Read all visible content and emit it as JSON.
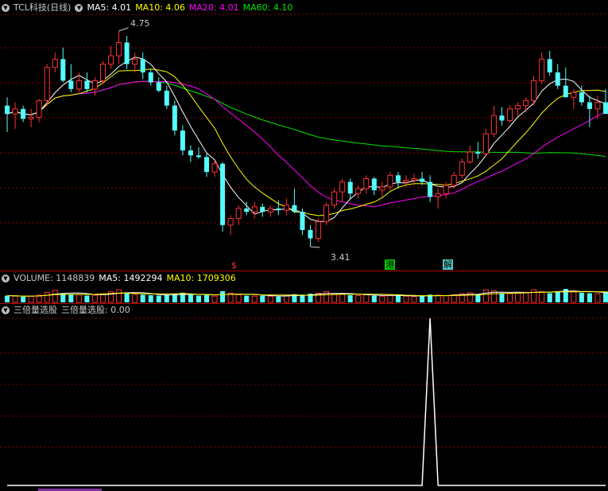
{
  "price_panel": {
    "title": "TCL科技(日线)",
    "ma5_label": "MA5: 4.01",
    "ma10_label": "MA10: 4.06",
    "ma20_label": "MA20: 4.01",
    "ma60_label": "MA60: 4.10",
    "high_label": "4.75",
    "low_label": "3.41",
    "markers": [
      "$",
      "港",
      "解"
    ]
  },
  "volume_panel": {
    "label": "VOLUME: 1148839",
    "ma5_label": "MA5: 1492294",
    "ma10_label": "MA10: 1709306"
  },
  "indicator_panel": {
    "title": "三倍量选股",
    "value_label": "三倍量选股: 0.00"
  },
  "colors": {
    "up": "#ff3232",
    "down": "#54fcfc",
    "ma5": "#ffffff",
    "ma10": "#ffff00",
    "ma20": "#ff00ff",
    "ma60": "#00e600",
    "grid": "#8b0000"
  },
  "chart_data": {
    "type": "candlestick",
    "price_range": [
      3.33,
      4.85
    ],
    "candles": [
      {
        "o": 4.3,
        "h": 4.35,
        "l": 4.14,
        "c": 4.25
      },
      {
        "o": 4.25,
        "h": 4.32,
        "l": 4.16,
        "c": 4.28
      },
      {
        "o": 4.28,
        "h": 4.3,
        "l": 4.2,
        "c": 4.22
      },
      {
        "o": 4.22,
        "h": 4.28,
        "l": 4.17,
        "c": 4.23
      },
      {
        "o": 4.23,
        "h": 4.34,
        "l": 4.2,
        "c": 4.33
      },
      {
        "o": 4.33,
        "h": 4.55,
        "l": 4.3,
        "c": 4.53
      },
      {
        "o": 4.53,
        "h": 4.62,
        "l": 4.5,
        "c": 4.58
      },
      {
        "o": 4.58,
        "h": 4.65,
        "l": 4.44,
        "c": 4.45
      },
      {
        "o": 4.45,
        "h": 4.55,
        "l": 4.38,
        "c": 4.4
      },
      {
        "o": 4.4,
        "h": 4.5,
        "l": 4.38,
        "c": 4.45
      },
      {
        "o": 4.45,
        "h": 4.5,
        "l": 4.38,
        "c": 4.4
      },
      {
        "o": 4.4,
        "h": 4.47,
        "l": 4.36,
        "c": 4.45
      },
      {
        "o": 4.45,
        "h": 4.57,
        "l": 4.43,
        "c": 4.55
      },
      {
        "o": 4.55,
        "h": 4.66,
        "l": 4.52,
        "c": 4.6
      },
      {
        "o": 4.6,
        "h": 4.75,
        "l": 4.55,
        "c": 4.68
      },
      {
        "o": 4.68,
        "h": 4.72,
        "l": 4.52,
        "c": 4.55
      },
      {
        "o": 4.55,
        "h": 4.62,
        "l": 4.5,
        "c": 4.58
      },
      {
        "o": 4.58,
        "h": 4.62,
        "l": 4.46,
        "c": 4.5
      },
      {
        "o": 4.5,
        "h": 4.52,
        "l": 4.42,
        "c": 4.44
      },
      {
        "o": 4.44,
        "h": 4.47,
        "l": 4.38,
        "c": 4.39
      },
      {
        "o": 4.39,
        "h": 4.42,
        "l": 4.28,
        "c": 4.3
      },
      {
        "o": 4.3,
        "h": 4.33,
        "l": 4.12,
        "c": 4.15
      },
      {
        "o": 4.15,
        "h": 4.18,
        "l": 4.0,
        "c": 4.03
      },
      {
        "o": 4.03,
        "h": 4.06,
        "l": 3.96,
        "c": 4.0
      },
      {
        "o": 4.0,
        "h": 4.05,
        "l": 3.98,
        "c": 3.99
      },
      {
        "o": 3.99,
        "h": 4.01,
        "l": 3.87,
        "c": 3.9
      },
      {
        "o": 3.9,
        "h": 3.97,
        "l": 3.87,
        "c": 3.95
      },
      {
        "o": 3.95,
        "h": 3.96,
        "l": 3.54,
        "c": 3.58
      },
      {
        "o": 3.58,
        "h": 3.64,
        "l": 3.52,
        "c": 3.62
      },
      {
        "o": 3.62,
        "h": 3.7,
        "l": 3.58,
        "c": 3.68
      },
      {
        "o": 3.68,
        "h": 3.72,
        "l": 3.64,
        "c": 3.66
      },
      {
        "o": 3.66,
        "h": 3.72,
        "l": 3.62,
        "c": 3.69
      },
      {
        "o": 3.69,
        "h": 3.71,
        "l": 3.63,
        "c": 3.66
      },
      {
        "o": 3.66,
        "h": 3.7,
        "l": 3.63,
        "c": 3.68
      },
      {
        "o": 3.68,
        "h": 3.73,
        "l": 3.64,
        "c": 3.67
      },
      {
        "o": 3.67,
        "h": 3.74,
        "l": 3.64,
        "c": 3.7
      },
      {
        "o": 3.7,
        "h": 3.8,
        "l": 3.65,
        "c": 3.66
      },
      {
        "o": 3.66,
        "h": 3.68,
        "l": 3.52,
        "c": 3.55
      },
      {
        "o": 3.55,
        "h": 3.58,
        "l": 3.45,
        "c": 3.5
      },
      {
        "o": 3.5,
        "h": 3.62,
        "l": 3.48,
        "c": 3.6
      },
      {
        "o": 3.6,
        "h": 3.72,
        "l": 3.58,
        "c": 3.7
      },
      {
        "o": 3.7,
        "h": 3.8,
        "l": 3.68,
        "c": 3.78
      },
      {
        "o": 3.78,
        "h": 3.86,
        "l": 3.72,
        "c": 3.84
      },
      {
        "o": 3.84,
        "h": 3.86,
        "l": 3.74,
        "c": 3.77
      },
      {
        "o": 3.77,
        "h": 3.82,
        "l": 3.74,
        "c": 3.8
      },
      {
        "o": 3.8,
        "h": 3.88,
        "l": 3.77,
        "c": 3.86
      },
      {
        "o": 3.86,
        "h": 3.87,
        "l": 3.76,
        "c": 3.79
      },
      {
        "o": 3.79,
        "h": 3.84,
        "l": 3.75,
        "c": 3.81
      },
      {
        "o": 3.81,
        "h": 3.9,
        "l": 3.79,
        "c": 3.88
      },
      {
        "o": 3.88,
        "h": 3.9,
        "l": 3.8,
        "c": 3.84
      },
      {
        "o": 3.84,
        "h": 3.88,
        "l": 3.81,
        "c": 3.85
      },
      {
        "o": 3.85,
        "h": 3.89,
        "l": 3.82,
        "c": 3.86
      },
      {
        "o": 3.86,
        "h": 3.9,
        "l": 3.82,
        "c": 3.84
      },
      {
        "o": 3.84,
        "h": 3.88,
        "l": 3.72,
        "c": 3.75
      },
      {
        "o": 3.75,
        "h": 3.8,
        "l": 3.68,
        "c": 3.77
      },
      {
        "o": 3.77,
        "h": 3.84,
        "l": 3.74,
        "c": 3.82
      },
      {
        "o": 3.82,
        "h": 3.9,
        "l": 3.8,
        "c": 3.88
      },
      {
        "o": 3.88,
        "h": 3.98,
        "l": 3.86,
        "c": 3.96
      },
      {
        "o": 3.96,
        "h": 4.06,
        "l": 3.95,
        "c": 4.02
      },
      {
        "o": 4.02,
        "h": 4.08,
        "l": 3.98,
        "c": 4.01
      },
      {
        "o": 4.01,
        "h": 4.16,
        "l": 4.0,
        "c": 4.13
      },
      {
        "o": 4.13,
        "h": 4.3,
        "l": 4.11,
        "c": 4.24
      },
      {
        "o": 4.24,
        "h": 4.29,
        "l": 4.18,
        "c": 4.21
      },
      {
        "o": 4.21,
        "h": 4.3,
        "l": 4.2,
        "c": 4.28
      },
      {
        "o": 4.28,
        "h": 4.32,
        "l": 4.24,
        "c": 4.3
      },
      {
        "o": 4.3,
        "h": 4.35,
        "l": 4.26,
        "c": 4.33
      },
      {
        "o": 4.33,
        "h": 4.48,
        "l": 4.3,
        "c": 4.45
      },
      {
        "o": 4.45,
        "h": 4.62,
        "l": 4.43,
        "c": 4.58
      },
      {
        "o": 4.58,
        "h": 4.63,
        "l": 4.48,
        "c": 4.5
      },
      {
        "o": 4.5,
        "h": 4.55,
        "l": 4.4,
        "c": 4.42
      },
      {
        "o": 4.42,
        "h": 4.53,
        "l": 4.36,
        "c": 4.35
      },
      {
        "o": 4.35,
        "h": 4.4,
        "l": 4.28,
        "c": 4.38
      },
      {
        "o": 4.38,
        "h": 4.42,
        "l": 4.3,
        "c": 4.32
      },
      {
        "o": 4.32,
        "h": 4.36,
        "l": 4.17,
        "c": 4.28
      },
      {
        "o": 4.28,
        "h": 4.36,
        "l": 4.22,
        "c": 4.32
      },
      {
        "o": 4.32,
        "h": 4.4,
        "l": 4.26,
        "c": 4.25
      }
    ],
    "volume": [
      1.4,
      1.3,
      1.2,
      1.3,
      1.5,
      2.1,
      2.5,
      1.9,
      1.7,
      1.6,
      1.4,
      1.5,
      1.8,
      2.2,
      2.6,
      1.9,
      1.7,
      1.6,
      1.5,
      1.4,
      1.5,
      1.8,
      2.0,
      1.6,
      1.4,
      1.5,
      1.3,
      2.3,
      1.9,
      1.6,
      1.4,
      1.3,
      1.4,
      1.3,
      1.2,
      1.4,
      1.7,
      1.6,
      1.8,
      1.9,
      2.2,
      1.8,
      1.7,
      1.5,
      1.4,
      1.6,
      1.4,
      1.3,
      1.5,
      1.4,
      1.3,
      1.2,
      1.3,
      1.6,
      1.5,
      1.4,
      1.6,
      1.8,
      2.0,
      1.7,
      2.6,
      2.4,
      1.9,
      1.8,
      1.9,
      2.1,
      2.6,
      2.2,
      1.9,
      2.3,
      2.8,
      2.4,
      2.0,
      1.9,
      1.8,
      2.0,
      1.9,
      1.7
    ],
    "indicator_range": [
      0,
      1
    ],
    "indicator_spike_index": 53,
    "indicator_spike_value": 1
  }
}
